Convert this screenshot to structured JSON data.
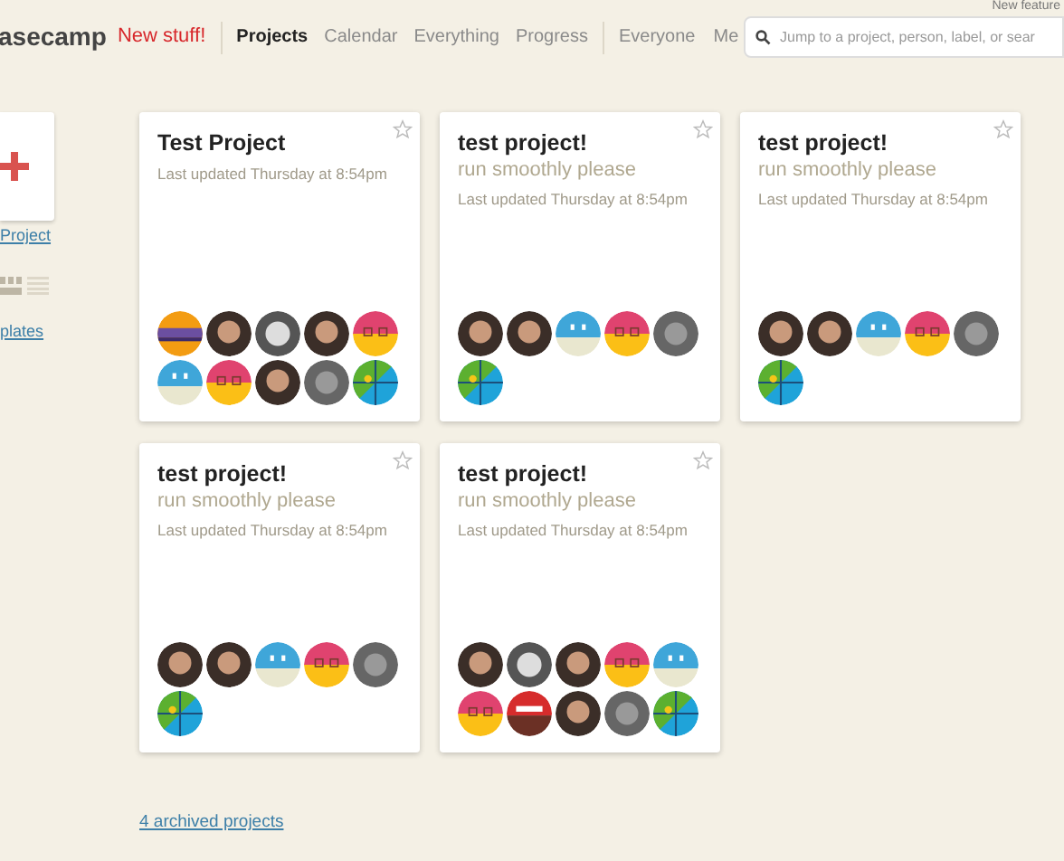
{
  "header": {
    "logo": "asecamp",
    "new_stuff": "New stuff!",
    "nav": [
      {
        "label": "Projects",
        "selected": true
      },
      {
        "label": "Calendar",
        "selected": false
      },
      {
        "label": "Everything",
        "selected": false
      },
      {
        "label": "Progress",
        "selected": false
      }
    ],
    "nav_people": [
      {
        "label": "Everyone",
        "selected": false
      },
      {
        "label": "Me",
        "selected": false
      }
    ],
    "new_features": "New feature",
    "search": {
      "placeholder": "Jump to a project, person, label, or sear"
    }
  },
  "sidebar": {
    "new_project_link": "Project",
    "templates_link": "plates",
    "view_toggle": [
      {
        "kind": "grid",
        "selected": true
      },
      {
        "kind": "list",
        "selected": false
      }
    ]
  },
  "projects": [
    {
      "title": "Test Project",
      "updated": "Last updated Thursday at 8:54pm",
      "starred": false,
      "avatars": [
        {
          "kind": "orange"
        },
        {
          "kind": "photo"
        },
        {
          "kind": "bw-photo"
        },
        {
          "kind": "photo"
        },
        {
          "kind": "pink"
        },
        {
          "kind": "robot"
        },
        {
          "kind": "pink"
        },
        {
          "kind": "photo"
        },
        {
          "kind": "gray-photo"
        },
        {
          "kind": "map"
        }
      ]
    },
    {
      "title": "test project!",
      "subtitle": "run smoothly please",
      "updated": "Last updated Thursday at 8:54pm",
      "starred": false,
      "avatars": [
        {
          "kind": "photo"
        },
        {
          "kind": "photo"
        },
        {
          "kind": "robot"
        },
        {
          "kind": "pink"
        },
        {
          "kind": "gray-photo"
        },
        {
          "kind": "map"
        }
      ]
    },
    {
      "title": "test project!",
      "subtitle": "run smoothly please",
      "updated": "Last updated Thursday at 8:54pm",
      "starred": false,
      "avatars": [
        {
          "kind": "photo"
        },
        {
          "kind": "photo"
        },
        {
          "kind": "robot"
        },
        {
          "kind": "pink"
        },
        {
          "kind": "gray-photo"
        },
        {
          "kind": "map"
        }
      ]
    },
    {
      "title": "test project!",
      "subtitle": "run smoothly please",
      "updated": "Last updated Thursday at 8:54pm",
      "starred": false,
      "avatars": [
        {
          "kind": "photo"
        },
        {
          "kind": "photo"
        },
        {
          "kind": "robot"
        },
        {
          "kind": "pink"
        },
        {
          "kind": "gray-photo"
        },
        {
          "kind": "map"
        }
      ]
    },
    {
      "title": "test project!",
      "subtitle": "run smoothly please",
      "updated": "Last updated Thursday at 8:54pm",
      "starred": false,
      "avatars": [
        {
          "kind": "photo"
        },
        {
          "kind": "bw-photo"
        },
        {
          "kind": "photo"
        },
        {
          "kind": "pink"
        },
        {
          "kind": "robot"
        },
        {
          "kind": "pink"
        },
        {
          "kind": "red"
        },
        {
          "kind": "photo"
        },
        {
          "kind": "gray-photo"
        },
        {
          "kind": "map"
        }
      ]
    }
  ],
  "archived_link": "4 archived projects"
}
